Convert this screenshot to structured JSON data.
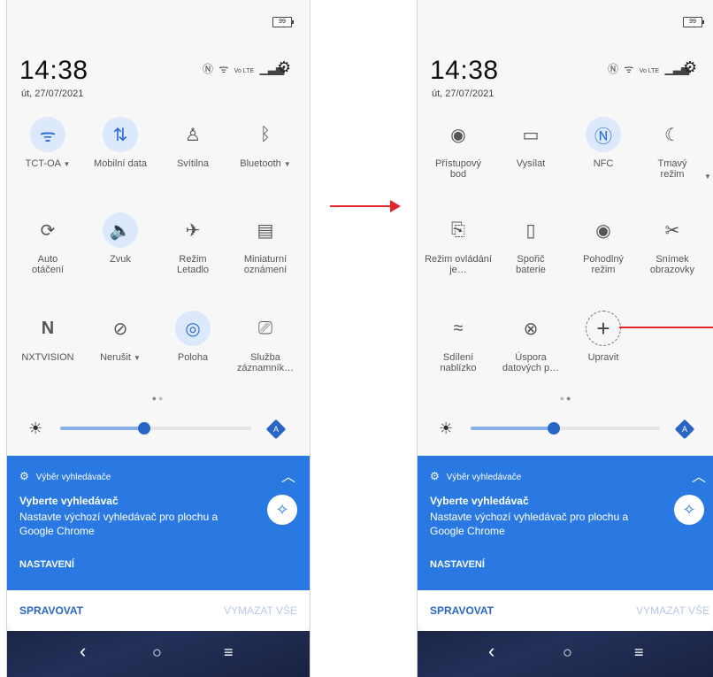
{
  "status": {
    "battery": "99",
    "lte": "Vo LTE",
    "signal": "▁▃▅",
    "wifi": "ᯤ",
    "nfc": "Ⓝ"
  },
  "left": {
    "time": "14:38",
    "date": "út, 27/07/2021",
    "tiles": [
      {
        "label": "TCT-OA",
        "caret": "▼",
        "active": true
      },
      {
        "label": "Mobilní data",
        "active": true
      },
      {
        "label": "Svítilna",
        "active": false
      },
      {
        "label": "Bluetooth",
        "caret": "▼",
        "active": false
      },
      {
        "label": "Auto otáčení",
        "active": false
      },
      {
        "label": "Zvuk",
        "active": true
      },
      {
        "label": "Režim Letadlo",
        "active": false
      },
      {
        "label": "Miniaturní oznámení",
        "active": false
      },
      {
        "label": "NXTVISION",
        "active": false
      },
      {
        "label": "Nerušit",
        "caret": "▼",
        "active": false
      },
      {
        "label": "Poloha",
        "active": true
      },
      {
        "label": "Služba záznamník…",
        "active": false
      }
    ],
    "brightness": 0.44,
    "auto_label": "A"
  },
  "right": {
    "time": "14:38",
    "date": "út, 27/07/2021",
    "tiles": [
      {
        "label": "Přístupový bod",
        "active": false
      },
      {
        "label": "Vysílat",
        "active": false
      },
      {
        "label": "NFC",
        "active": true
      },
      {
        "label": "Tmavý režim",
        "active": false
      },
      {
        "label": "Režim ovládání je…",
        "active": false
      },
      {
        "label": "Spořič baterie",
        "active": false
      },
      {
        "label": "Pohodlný režim",
        "active": false
      },
      {
        "label": "Snímek obrazovky",
        "active": false
      },
      {
        "label": "Sdílení nablízko",
        "active": false
      },
      {
        "label": "Úspora datových p…",
        "active": false
      },
      {
        "label": "Upravit",
        "active": false
      }
    ],
    "brightness": 0.44,
    "auto_label": "A"
  },
  "notification": {
    "app": "Výběr vyhledávače",
    "title": "Vyberte vyhledávač",
    "body": "Nastavte výchozí vyhledávač pro plochu a Google Chrome",
    "action": "NASTAVENÍ"
  },
  "bottom_bar": {
    "manage": "SPRAVOVAT",
    "clear": "VYMAZAT VŠE"
  },
  "nav": {
    "back": "‹",
    "home": "○",
    "recents": "≡"
  },
  "colors": {
    "accent": "#2a79e2",
    "annotation": "#e0262a"
  }
}
